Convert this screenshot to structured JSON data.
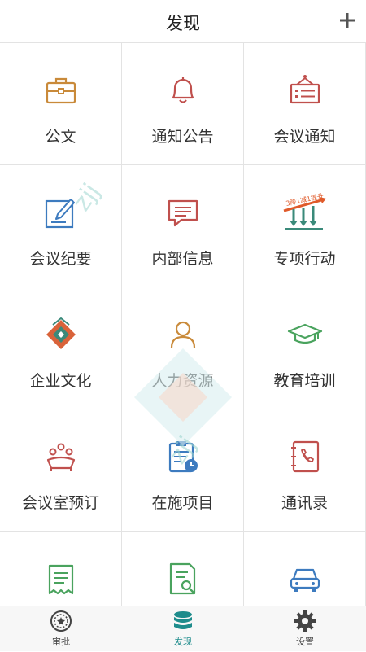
{
  "header": {
    "title": "发现"
  },
  "grid": {
    "items": [
      {
        "label": "公文",
        "icon": "briefcase-icon"
      },
      {
        "label": "通知公告",
        "icon": "bell-icon"
      },
      {
        "label": "会议通知",
        "icon": "meeting-sign-icon"
      },
      {
        "label": "会议纪要",
        "icon": "edit-note-icon"
      },
      {
        "label": "内部信息",
        "icon": "message-icon"
      },
      {
        "label": "专项行动",
        "icon": "special-action-icon",
        "badge": "3降1减1提升"
      },
      {
        "label": "企业文化",
        "icon": "culture-logo-icon"
      },
      {
        "label": "人力资源",
        "icon": "person-icon"
      },
      {
        "label": "教育培训",
        "icon": "graduation-cap-icon"
      },
      {
        "label": "会议室预订",
        "icon": "meeting-room-icon"
      },
      {
        "label": "在施项目",
        "icon": "clipboard-clock-icon"
      },
      {
        "label": "通讯录",
        "icon": "contacts-book-icon"
      },
      {
        "label": "",
        "icon": "receipt-icon"
      },
      {
        "label": "",
        "icon": "document-search-icon"
      },
      {
        "label": "",
        "icon": "car-icon"
      }
    ]
  },
  "watermark": {
    "text": "zjj"
  },
  "tabbar": {
    "tabs": [
      {
        "label": "审批",
        "icon": "approval-badge-icon"
      },
      {
        "label": "发现",
        "icon": "database-stack-icon",
        "active": true
      },
      {
        "label": "设置",
        "icon": "gear-icon"
      }
    ]
  },
  "colors": {
    "accent": "#1e8c8c",
    "red": "#c0504d",
    "orange": "#c98a3a",
    "blue": "#3d7bbf",
    "green": "#4aa35e"
  }
}
